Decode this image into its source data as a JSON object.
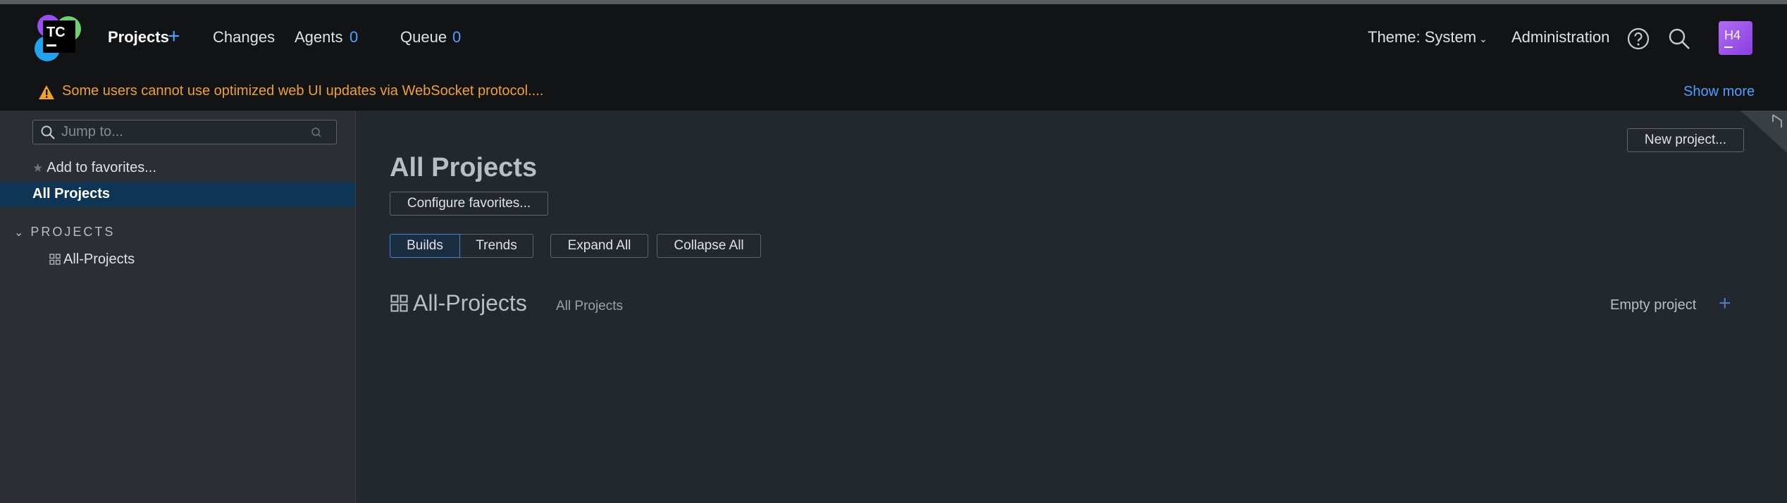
{
  "header": {
    "logo_text": "TC",
    "nav": {
      "projects": "Projects",
      "changes": "Changes",
      "agents": "Agents",
      "agents_count": "0",
      "queue": "Queue",
      "queue_count": "0"
    },
    "theme": "Theme: System",
    "administration": "Administration",
    "avatar_initials": "H4"
  },
  "banner": {
    "message": "Some users cannot use optimized web UI updates via WebSocket protocol....",
    "show_more": "Show more"
  },
  "sidebar": {
    "search_placeholder": "Jump to...",
    "add_favorites": "Add to favorites...",
    "all_projects": "All Projects",
    "projects_heading": "PROJECTS",
    "tree": [
      {
        "label": "All-Projects"
      }
    ]
  },
  "main": {
    "new_project": "New project...",
    "title": "All Projects",
    "configure_favorites": "Configure favorites...",
    "view_tabs": {
      "builds": "Builds",
      "trends": "Trends",
      "active": "Builds"
    },
    "expand_all": "Expand All",
    "collapse_all": "Collapse All",
    "project": {
      "name": "All-Projects",
      "description": "All Projects",
      "empty_label": "Empty project"
    }
  },
  "colors": {
    "accent": "#4ea0ff",
    "warning": "#f0a12c",
    "selected_row": "#0f3555",
    "avatar": "#9b51e8"
  }
}
